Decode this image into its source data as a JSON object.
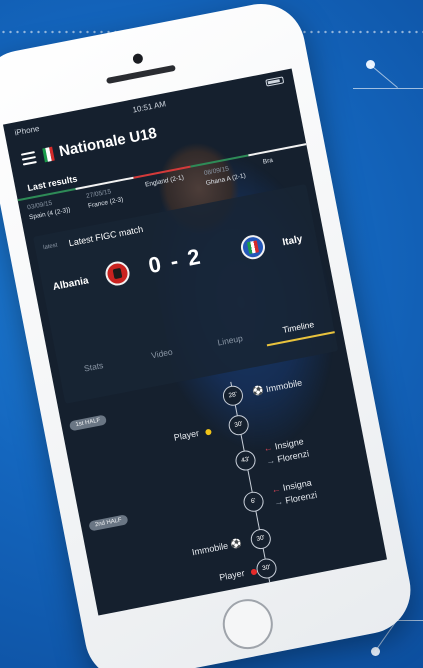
{
  "status_bar": {
    "carrier": "iPhone",
    "time": "10:51 AM"
  },
  "header": {
    "title": "Nationale U18"
  },
  "last_results": {
    "label": "Last results",
    "bar_colors": [
      "#2e8b57",
      "#f2f2f2",
      "#d33a3a",
      "#2e8b57",
      "#f2f2f2"
    ],
    "items": [
      {
        "date": "03/09/15",
        "teams": "Spain (4 (2-3))"
      },
      {
        "date": "27/05/15",
        "teams": "France (2-3)"
      },
      {
        "date": "",
        "teams": "England (2-1)"
      },
      {
        "date": "08/09/15",
        "teams": "Ghana A (2-1)"
      },
      {
        "date": "",
        "teams": "Bra"
      }
    ]
  },
  "match_card": {
    "badge": "latest",
    "title": "Latest FIGC match",
    "home_team": "Albania",
    "away_team": "Italy",
    "score": "0 - 2",
    "tabs": [
      {
        "label": "Stats",
        "active": false
      },
      {
        "label": "Video",
        "active": false
      },
      {
        "label": "Lineup",
        "active": false
      },
      {
        "label": "Timeline",
        "active": true
      }
    ]
  },
  "timeline": {
    "half_labels": [
      "1st HALF",
      "2nd HALF"
    ],
    "events": [
      {
        "minute": "28'",
        "right": "Immobile",
        "icon": "ball-icon"
      },
      {
        "minute": "30'",
        "left": "Player",
        "card": "yellow"
      },
      {
        "minute": "43'",
        "sub_in": "Insigne",
        "sub_out": "Florenzi"
      },
      {
        "minute": "6'",
        "sub_in": "Insigna",
        "sub_out": "Florenzi"
      },
      {
        "minute": "30'",
        "left": "Immobile",
        "icon": "ball-icon"
      },
      {
        "minute": "30'",
        "left": "Player",
        "card": "red"
      }
    ]
  }
}
